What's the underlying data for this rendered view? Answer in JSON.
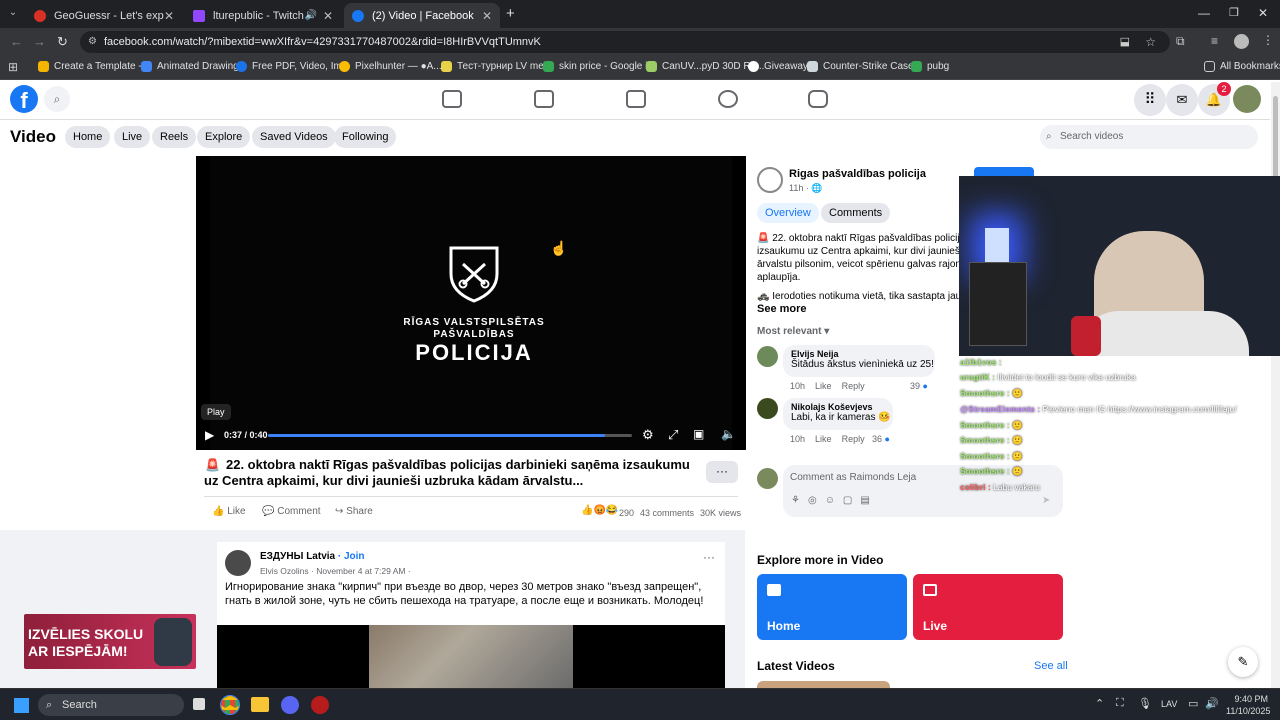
{
  "browser": {
    "tabs": [
      {
        "title": "GeoGuessr - Let's explore the w",
        "color": "#d93025"
      },
      {
        "title": "lturepublic - Twitch",
        "color": "#9146ff"
      },
      {
        "title": "(2) Video | Facebook",
        "color": "#1877f2"
      }
    ],
    "url": "facebook.com/watch/?mibextid=wwXIfr&v=4297331770487002&rdid=I8HIrBVVqtTUmnvK",
    "bookmarks": [
      {
        "label": "Create a Template -...",
        "color": "#f4b400"
      },
      {
        "label": "Animated Drawings",
        "color": "#4285f4"
      },
      {
        "label": "Free PDF, Video, Im...",
        "color": "#1a73e8"
      },
      {
        "label": "Pixelhunter — ●A...",
        "color": "#fbbc04"
      },
      {
        "label": "Тест-турнир LV mei...",
        "color": "#e8d24a"
      },
      {
        "label": "skin price - Google i...",
        "color": "#34a853"
      },
      {
        "label": "CanUV...pyD 30D Re...",
        "color": "#9ccc65"
      },
      {
        "label": "Giveaway",
        "color": "#ffffff"
      },
      {
        "label": "Counter-Strike Case...",
        "color": "#cfd8dc"
      },
      {
        "label": "pubg",
        "color": "#34a853"
      }
    ],
    "all_bookmarks": "All Bookmarks"
  },
  "fb": {
    "notif_count": "2",
    "section_title": "Video",
    "nav_pills": [
      "Home",
      "Live",
      "Reels",
      "Explore",
      "Saved Videos",
      "Following"
    ],
    "search_placeholder": "Search videos"
  },
  "player": {
    "logo_line1": "RĪGAS VALSTSPILSĒTAS",
    "logo_line2": "PAŠVALDĪBAS",
    "logo_line3": "POLICIJA",
    "tooltip": "Play",
    "time": "0:37 / 0:40",
    "progress_fraction": 0.925
  },
  "video_post": {
    "title": "22. oktobra naktī Rīgas pašvaldības policijas darbinieki saņēma izsaukumu uz Centra apkaimi, kur divi jaunieši uzbruka kādam ārvalstu...",
    "like": "Like",
    "comment": "Comment",
    "share": "Share",
    "reaction_count": "290",
    "comments_count": "43 comments",
    "views": "30K views"
  },
  "side": {
    "page_name": "Rigas pašvaldības policija",
    "time": "11h ·",
    "tab_overview": "Overview",
    "tab_comments": "Comments",
    "desc_line1": "22. oktobra naktī Rīgas pašvaldības policij",
    "desc_line2": "izsaukumu uz Centra apkaimi, kur divi jaunieš",
    "desc_line3": "ārvalstu pilsonim, veicot spērienu galvas rajon",
    "desc_line4": "aplaupīja.",
    "desc_line5": "Ierodoties notikuma vietā, tika sastapta jau",
    "see_more": "See more",
    "sort": "Most relevant",
    "comments": [
      {
        "name": "Elvijs Neija",
        "text": "Šitādus ākstus vienìniekā uz 25!",
        "time": "10h",
        "likes": "39"
      },
      {
        "name": "Nikolajs Koševjevs",
        "text": "Labi, ka ir kameras",
        "time": "10h",
        "likes": "36"
      }
    ],
    "like": "Like",
    "reply": "Reply",
    "comment_placeholder": "Comment as Raimonds Leja",
    "explore_title": "Explore more in Video",
    "card_home": "Home",
    "card_live": "Live",
    "latest_title": "Latest Videos",
    "see_all": "See all"
  },
  "feed_post": {
    "page": "ЕЗДУНЫ Latvia",
    "join": "· Join",
    "author": "Elvis Ozolins · November 4 at 7:29 AM ·",
    "text": "Игнорирование знака \"кирпич\" при въезде во двор, через 30 метров знако \"въезд запрещен\", гнать в жилой зоне, чуть не сбить пешехода на тратуаре, а после еще и возникать. Молодец!"
  },
  "ad": {
    "line1": "IZVĒLIES SKOLU",
    "line2": "AR IESPĒJĀM!"
  },
  "chat": [
    {
      "user": "a1lb1vos :",
      "msg": "",
      "color": "#9fe870"
    },
    {
      "user": "uragtiK :",
      "msg": "Iliviidet to loodit se kuro vika uzbruka",
      "color": "#9fe870"
    },
    {
      "user": "Smoothsre :",
      "msg": "",
      "color": "#9fe870"
    },
    {
      "user": "@StreamElements :",
      "msg": "Pievieno man IG https://www.instagram.com/llllllaju/",
      "color": "#c58cff"
    },
    {
      "user": "Smoothsre :",
      "msg": "",
      "color": "#9fe870"
    },
    {
      "user": "Smoothsre :",
      "msg": "",
      "color": "#9fe870"
    },
    {
      "user": "Smoothsre :",
      "msg": "",
      "color": "#9fe870"
    },
    {
      "user": "Smoothsre :",
      "msg": "",
      "color": "#9fe870"
    },
    {
      "user": "colibri :",
      "msg": "Labu vakaru",
      "color": "#ff5b5b"
    }
  ],
  "taskbar": {
    "search": "Search",
    "lang": "LAV",
    "time": "9:40 PM",
    "date": "11/10/2025"
  }
}
